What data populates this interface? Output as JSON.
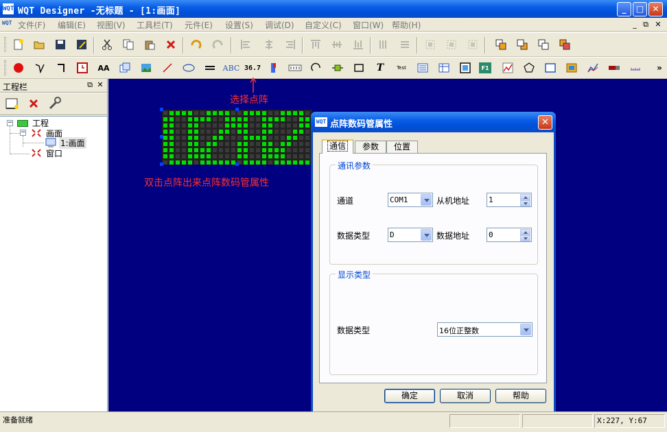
{
  "window": {
    "logo": "WQT",
    "title": "WQT Designer -无标题 - [1:画面]",
    "controls": [
      "minimize",
      "maximize",
      "close"
    ]
  },
  "menu": {
    "items": [
      "文件(F)",
      "编辑(E)",
      "视图(V)",
      "工具栏(T)",
      "元件(E)",
      "设置(S)",
      "调试(D)",
      "自定义(C)",
      "窗口(W)",
      "帮助(H)"
    ],
    "mdi_controls": [
      "minimize",
      "restore",
      "close"
    ]
  },
  "toolbar1": {
    "icons": [
      "new-file-icon",
      "open-folder-icon",
      "save-icon",
      "save-as-icon",
      "cut-icon",
      "copy-icon",
      "paste-icon",
      "delete-icon",
      "undo-icon",
      "redo-icon",
      "align-left-icon",
      "align-center-h-icon",
      "align-right-icon",
      "align-top-icon",
      "align-middle-v-icon",
      "align-bottom-icon",
      "same-width-icon",
      "same-height-icon",
      "center-h-icon",
      "center-v-icon",
      "center-both-icon",
      "bring-front-icon",
      "send-back-icon",
      "bring-forward-icon",
      "send-backward-icon"
    ]
  },
  "toolbar2": {
    "icons": [
      "record-icon",
      "polyline-icon",
      "bracket-icon",
      "clock-icon",
      "text-size-icon",
      "copy-window-icon",
      "picture-icon",
      "line-icon",
      "ellipse-icon",
      "double-line-icon",
      "abc-text-icon",
      "number-display-icon",
      "flag-icon",
      "dot-matrix-icon",
      "arc-icon",
      "component-icon",
      "rectangle-icon",
      "italic-text-icon",
      "test-icon",
      "list-icon",
      "table-icon",
      "frame-icon",
      "function-key-icon",
      "chart-icon",
      "polygon-icon",
      "square-icon",
      "image-icon",
      "trend-icon",
      "bar-icon",
      "scale-icon",
      "more-icon"
    ],
    "number_display_label": "36.7",
    "abc_label": "ABC",
    "test_label": "Test",
    "fkey_label": "F1"
  },
  "project_panel": {
    "title": "工程栏",
    "tools": [
      "new-screen-icon",
      "delete-icon",
      "settings-wrench-icon"
    ],
    "tree": {
      "root": "工程",
      "screens": "画面",
      "screen_item": "1:画面",
      "windows": "窗口"
    }
  },
  "canvas": {
    "background": "#000080",
    "annotation_top": "选择点阵",
    "annotation_bottom": "双击点阵出来点阵数码管属性",
    "led_color": "#00e000",
    "annotation_color": "#ff3030"
  },
  "dialog": {
    "logo": "WQT",
    "title": "点阵数码管属性",
    "tabs": [
      "通信",
      "参数",
      "位置"
    ],
    "active_tab": "通信",
    "comm_group": {
      "title": "通讯参数",
      "channel_label": "通道",
      "channel_value": "COM1",
      "slave_label": "从机地址",
      "slave_value": "1",
      "datatype_label": "数据类型",
      "datatype_value": "D",
      "address_label": "数据地址",
      "address_value": "0"
    },
    "display_group": {
      "title": "显示类型",
      "datatype_label": "数据类型",
      "datatype_value": "16位正整数"
    },
    "buttons": {
      "ok": "确定",
      "cancel": "取消",
      "help": "帮助"
    }
  },
  "statusbar": {
    "ready": "准备就绪",
    "coords": "X:227, Y:67"
  }
}
